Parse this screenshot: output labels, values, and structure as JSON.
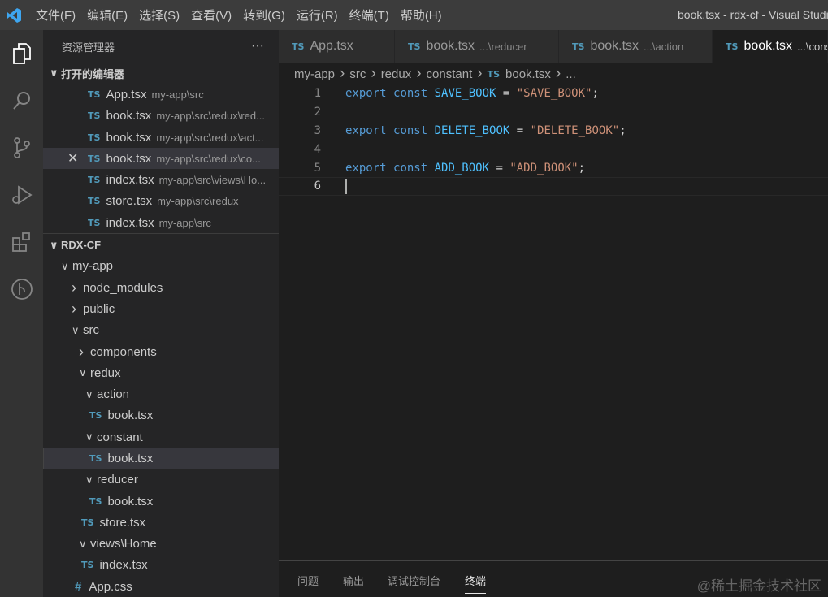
{
  "menu": [
    "文件(F)",
    "编辑(E)",
    "选择(S)",
    "查看(V)",
    "转到(G)",
    "运行(R)",
    "终端(T)",
    "帮助(H)"
  ],
  "window_title": "book.tsx - rdx-cf - Visual Studio Code",
  "sidebar": {
    "title": "资源管理器",
    "more": "···",
    "open_editors_label": "打开的编辑器",
    "open_editors": [
      {
        "name": "App.tsx",
        "path": "my-app\\src"
      },
      {
        "name": "book.tsx",
        "path": "my-app\\src\\redux\\red..."
      },
      {
        "name": "book.tsx",
        "path": "my-app\\src\\redux\\act..."
      },
      {
        "name": "book.tsx",
        "path": "my-app\\src\\redux\\co..."
      },
      {
        "name": "index.tsx",
        "path": "my-app\\src\\views\\Ho..."
      },
      {
        "name": "store.tsx",
        "path": "my-app\\src\\redux"
      },
      {
        "name": "index.tsx",
        "path": "my-app\\src"
      }
    ],
    "workspace": "RDX-CF",
    "tree": [
      {
        "name": "my-app",
        "type": "folder-open",
        "depth": 0
      },
      {
        "name": "node_modules",
        "type": "folder",
        "depth": 1
      },
      {
        "name": "public",
        "type": "folder",
        "depth": 1
      },
      {
        "name": "src",
        "type": "folder-open",
        "depth": 1
      },
      {
        "name": "components",
        "type": "folder",
        "depth": 2
      },
      {
        "name": "redux",
        "type": "folder-open",
        "depth": 2
      },
      {
        "name": "action",
        "type": "folder-open",
        "depth": 3
      },
      {
        "name": "book.tsx",
        "type": "ts",
        "depth": 4
      },
      {
        "name": "constant",
        "type": "folder-open",
        "depth": 3
      },
      {
        "name": "book.tsx",
        "type": "ts",
        "depth": 4,
        "selected": true
      },
      {
        "name": "reducer",
        "type": "folder-open",
        "depth": 3
      },
      {
        "name": "book.tsx",
        "type": "ts",
        "depth": 4
      },
      {
        "name": "store.tsx",
        "type": "ts",
        "depth": 3
      },
      {
        "name": "views\\Home",
        "type": "folder-open",
        "depth": 2
      },
      {
        "name": "index.tsx",
        "type": "ts",
        "depth": 3
      },
      {
        "name": "App.css",
        "type": "css",
        "depth": 2
      }
    ]
  },
  "tabs": [
    {
      "name": "App.tsx",
      "desc": ""
    },
    {
      "name": "book.tsx",
      "desc": "...\\reducer"
    },
    {
      "name": "book.tsx",
      "desc": "...\\action"
    },
    {
      "name": "book.tsx",
      "desc": "...\\constant",
      "active": true
    }
  ],
  "ts_badge": "TS",
  "breadcrumb": [
    "my-app",
    "src",
    "redux",
    "constant",
    "book.tsx",
    "..."
  ],
  "code": [
    {
      "n": "1",
      "tokens": [
        [
          "kw",
          "export "
        ],
        [
          "kw",
          "const "
        ],
        [
          "id",
          "SAVE_BOOK"
        ],
        [
          "op",
          " = "
        ],
        [
          "str",
          "\"SAVE_BOOK\""
        ],
        [
          "op",
          ";"
        ]
      ]
    },
    {
      "n": "2",
      "tokens": []
    },
    {
      "n": "3",
      "tokens": [
        [
          "kw",
          "export "
        ],
        [
          "kw",
          "const "
        ],
        [
          "id",
          "DELETE_BOOK"
        ],
        [
          "op",
          " = "
        ],
        [
          "str",
          "\"DELETE_BOOK\""
        ],
        [
          "op",
          ";"
        ]
      ]
    },
    {
      "n": "4",
      "tokens": []
    },
    {
      "n": "5",
      "tokens": [
        [
          "kw",
          "export "
        ],
        [
          "kw",
          "const "
        ],
        [
          "id",
          "ADD_BOOK"
        ],
        [
          "op",
          " = "
        ],
        [
          "str",
          "\"ADD_BOOK\""
        ],
        [
          "op",
          ";"
        ]
      ]
    },
    {
      "n": "6",
      "tokens": [],
      "current": true
    }
  ],
  "panel_tabs": [
    "问题",
    "输出",
    "调试控制台",
    "终端"
  ],
  "watermark": "@稀土掘金技术社区"
}
